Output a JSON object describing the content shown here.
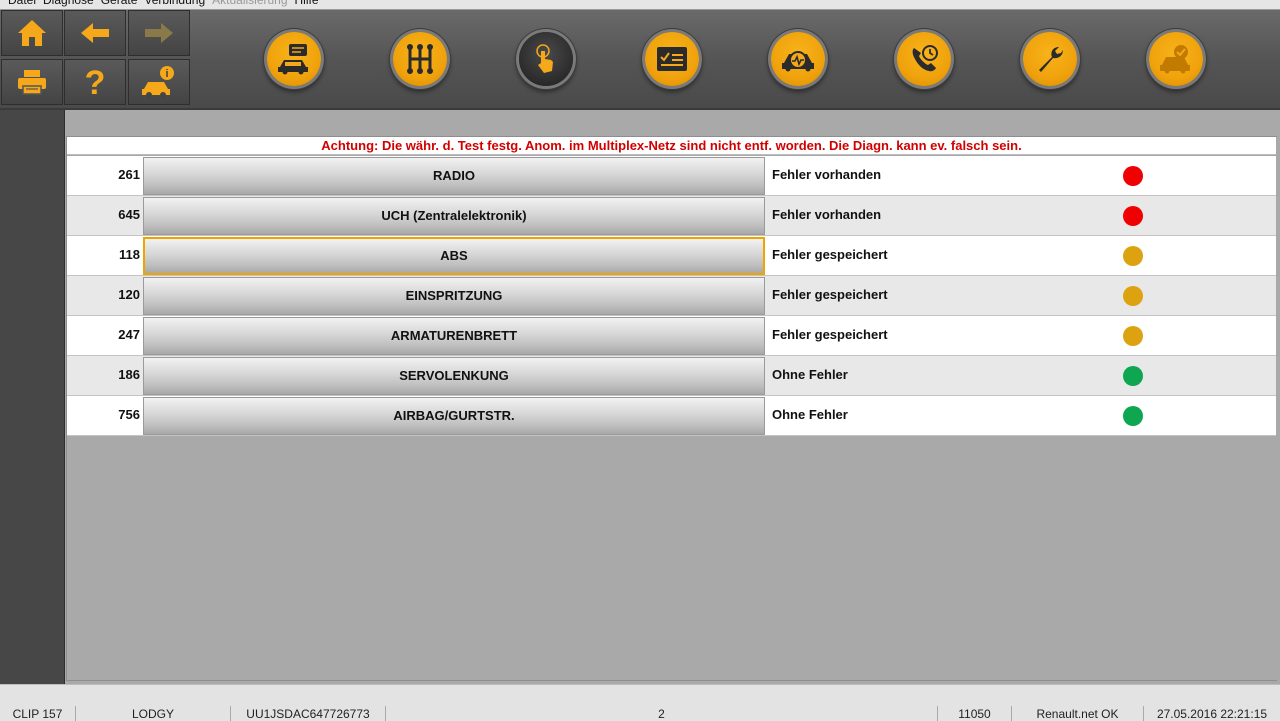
{
  "menu": {
    "items": [
      {
        "label": "Datei",
        "disabled": false
      },
      {
        "label": "Diagnose",
        "disabled": false
      },
      {
        "label": "Geräte",
        "disabled": false
      },
      {
        "label": "Verbindung",
        "disabled": false
      },
      {
        "label": "Aktualisierung",
        "disabled": true
      },
      {
        "label": "Hilfe",
        "disabled": false
      }
    ]
  },
  "toolbar": {
    "nav_buttons": [
      "home-icon",
      "back-arrow-icon",
      "forward-arrow-icon",
      "printer-icon",
      "help-icon",
      "vehicle-info-icon"
    ],
    "tool_buttons": [
      {
        "icon": "vehicle-identification-icon",
        "active": false
      },
      {
        "icon": "gearbox-icon",
        "active": false
      },
      {
        "icon": "touch-hand-icon",
        "active": true
      },
      {
        "icon": "checklist-icon",
        "active": false
      },
      {
        "icon": "vehicle-diagnostic-icon",
        "active": false
      },
      {
        "icon": "phone-support-icon",
        "active": false
      },
      {
        "icon": "wrench-icon",
        "active": false
      },
      {
        "icon": "vehicle-check-icon",
        "active": false
      }
    ]
  },
  "warning": "Achtung: Die währ. d. Test festg. Anom. im Multiplex-Netz sind nicht entf. worden. Die Diagn. kann ev. falsch sein.",
  "ecu_table": {
    "rows": [
      {
        "code": "261",
        "name": "RADIO",
        "status": "Fehler vorhanden",
        "color": "#f00000"
      },
      {
        "code": "645",
        "name": "UCH (Zentralelektronik)",
        "status": "Fehler vorhanden",
        "color": "#f00000"
      },
      {
        "code": "118",
        "name": "ABS",
        "status": "Fehler gespeichert",
        "color": "#dda20f",
        "selected": true
      },
      {
        "code": "120",
        "name": "EINSPRITZUNG",
        "status": "Fehler gespeichert",
        "color": "#dda20f"
      },
      {
        "code": "247",
        "name": "ARMATURENBRETT",
        "status": "Fehler gespeichert",
        "color": "#dda20f"
      },
      {
        "code": "186",
        "name": "SERVOLENKUNG",
        "status": "Ohne Fehler",
        "color": "#0ea650"
      },
      {
        "code": "756",
        "name": "AIRBAG/GURTSTR.",
        "status": "Ohne Fehler",
        "color": "#0ea650"
      }
    ]
  },
  "statusbar": {
    "tool": "CLIP 157",
    "vehicle": "LODGY",
    "vin": "UU1JSDAC647726773",
    "count": "2",
    "code": "11050",
    "network": "Renault.net OK",
    "datetime": "27.05.2016 22:21:15"
  },
  "colors": {
    "accent": "#f0a30a",
    "toolbar": "#555555",
    "error": "#f00000",
    "stored": "#dda20f",
    "ok": "#0ea650"
  }
}
